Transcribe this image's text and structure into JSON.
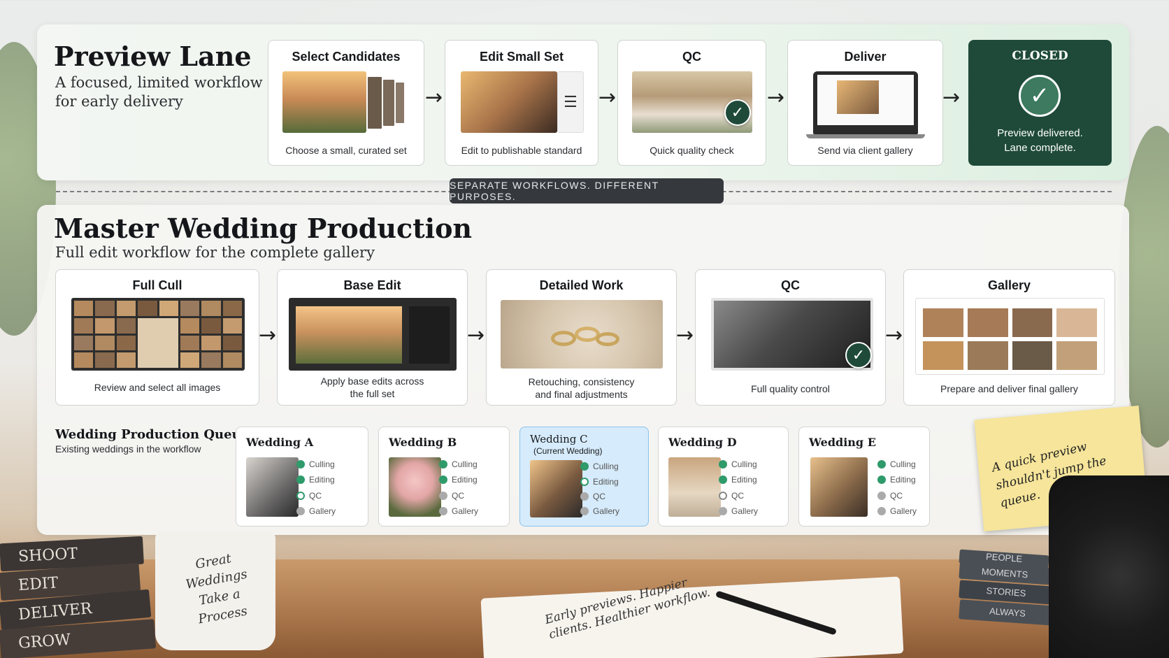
{
  "preview_lane": {
    "title": "Preview Lane",
    "subtitle_line1": "A focused, limited workflow",
    "subtitle_line2": "for early delivery",
    "steps": [
      {
        "title": "Select Candidates",
        "caption": "Choose a small, curated set"
      },
      {
        "title": "Edit Small Set",
        "caption": "Edit to publishable standard"
      },
      {
        "title": "QC",
        "caption": "Quick quality check"
      },
      {
        "title": "Deliver",
        "caption": "Send via client gallery"
      }
    ],
    "closed": {
      "title": "CLOSED",
      "line1": "Preview delivered.",
      "line2": "Lane complete."
    }
  },
  "separator": "SEPARATE WORKFLOWS. DIFFERENT PURPOSES.",
  "master": {
    "title": "Master Wedding Production",
    "subtitle": "Full edit workflow for the complete gallery",
    "steps": [
      {
        "title": "Full Cull",
        "caption": "Review and select all images"
      },
      {
        "title": "Base Edit",
        "caption_line1": "Apply base edits across",
        "caption_line2": "the full set"
      },
      {
        "title": "Detailed Work",
        "caption_line1": "Retouching, consistency",
        "caption_line2": "and final adjustments"
      },
      {
        "title": "QC",
        "caption": "Full quality control"
      },
      {
        "title": "Gallery",
        "caption": "Prepare and deliver final gallery"
      }
    ]
  },
  "queue": {
    "title": "Wedding Production Queue",
    "subtitle": "Existing weddings in the workflow",
    "status_labels": [
      "Culling",
      "Editing",
      "QC",
      "Gallery"
    ],
    "weddings": [
      {
        "name": "Wedding A",
        "status": [
          "done",
          "done",
          "active",
          "pending"
        ]
      },
      {
        "name": "Wedding B",
        "status": [
          "done",
          "done",
          "pending",
          "pending"
        ]
      },
      {
        "name": "Wedding C",
        "note": "(Current Wedding)",
        "status": [
          "done",
          "active",
          "pending",
          "pending"
        ]
      },
      {
        "name": "Wedding D",
        "status": [
          "done",
          "done",
          "active",
          "pending"
        ]
      },
      {
        "name": "Wedding E",
        "status": [
          "done",
          "done",
          "pending",
          "pending"
        ]
      }
    ]
  },
  "sticky_note": "A quick preview shouldn't jump the queue.",
  "books": [
    "SHOOT",
    "EDIT",
    "DELIVER",
    "GROW"
  ],
  "mug_text": "Great Weddings Take a Process",
  "notebook_text": "Early previews. Happier clients. Healthier workflow.",
  "book_stack": [
    "PEOPLE",
    "MOMENTS",
    "STORIES",
    "ALWAYS"
  ],
  "colors": {
    "accent_green": "#1f4a3a",
    "status_done": "#2f9a6a",
    "current_highlight": "#d6ebfb"
  }
}
